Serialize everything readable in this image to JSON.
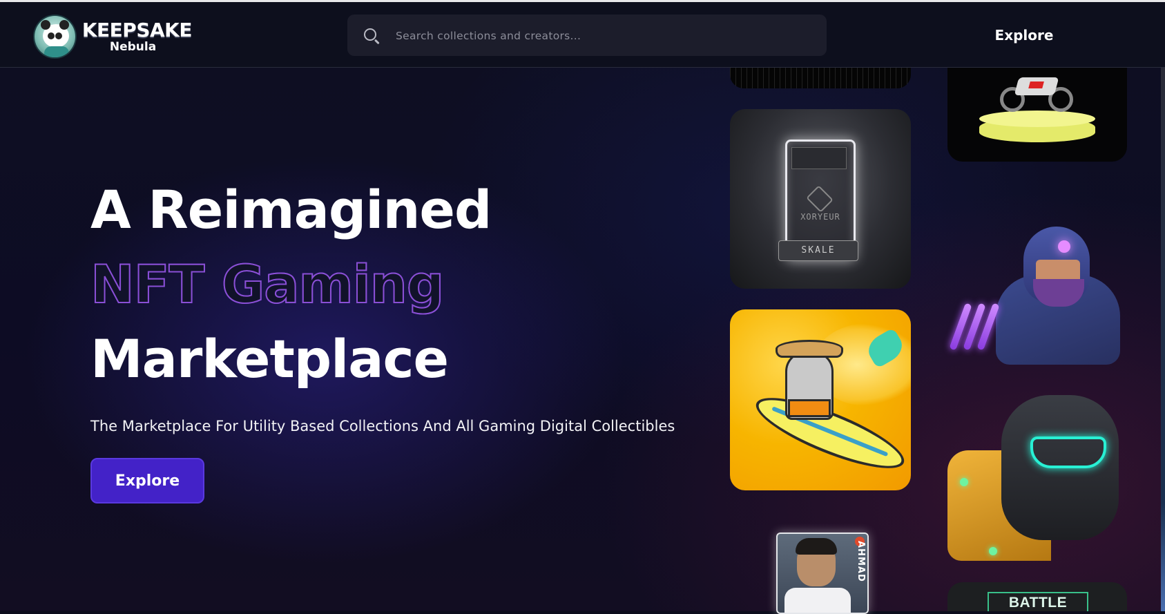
{
  "brand": {
    "name": "KEEPSAKE",
    "sub": "Nebula"
  },
  "search": {
    "placeholder": "Search collections and creators...",
    "icon": "search-icon"
  },
  "nav": {
    "explore_label": "Explore"
  },
  "hero": {
    "line1": "A Reimagined",
    "line2": "NFT Gaming",
    "line3": "Marketplace",
    "subtitle": "The Marketplace For Utility Based Collections And All Gaming Digital Collectibles",
    "cta_label": "Explore",
    "accent_color": "#4322c8",
    "outline_gradient": [
      "#6b3fd0",
      "#b94fcf"
    ]
  },
  "cards": {
    "skale_word": "XORYEUR",
    "skale_label": "SKALE",
    "cricket_name": "AHMAD",
    "battle_label": "BATTLE PASS"
  }
}
